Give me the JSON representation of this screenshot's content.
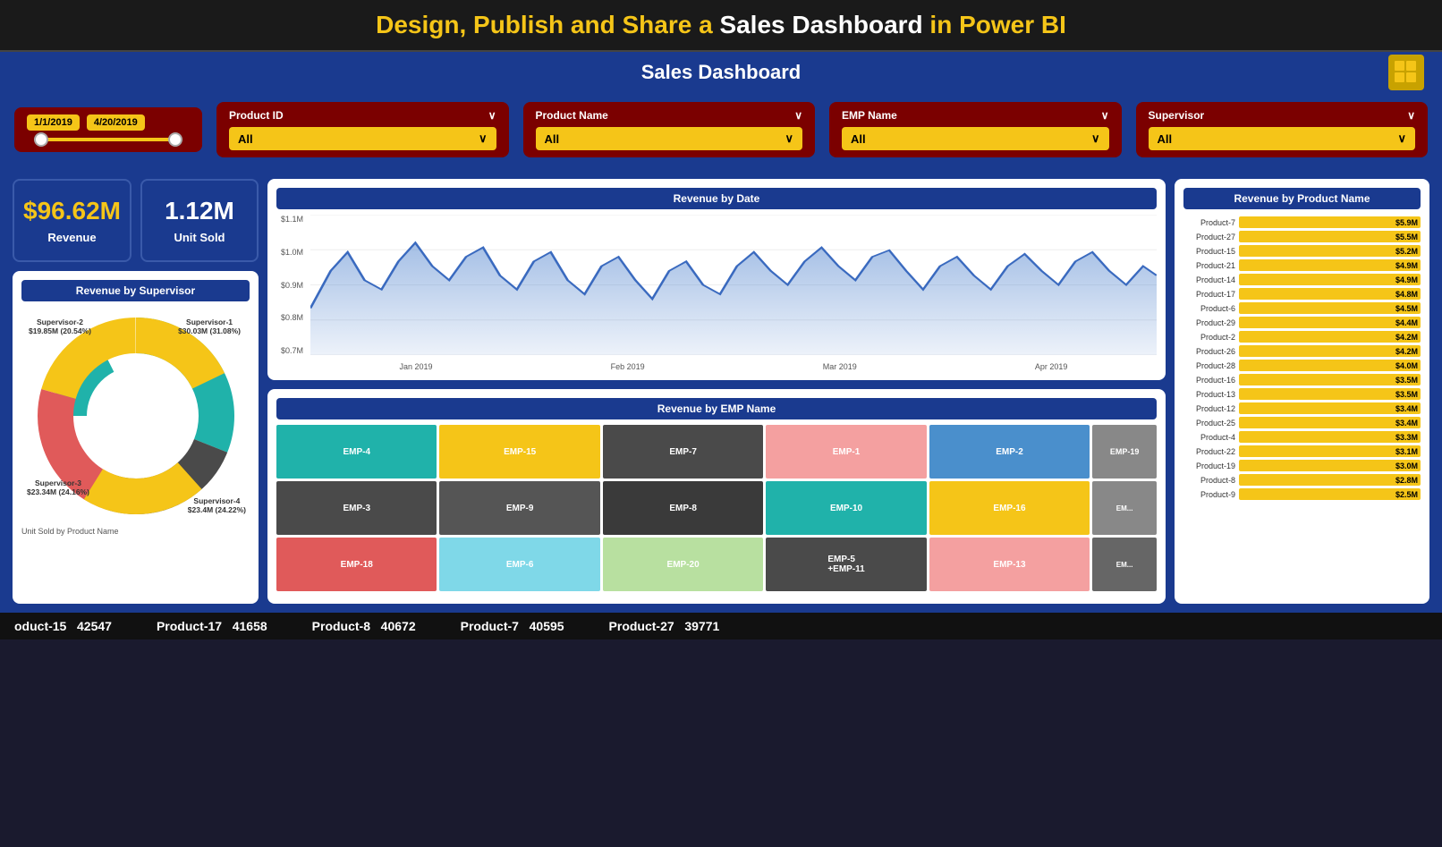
{
  "title_bar": {
    "text_yellow": "Design, Publish and Share a ",
    "text_white": "Sales Dashboard",
    "text_yellow2": " in Power BI"
  },
  "header": {
    "title": "Sales Dashboard"
  },
  "filters": {
    "date": {
      "start": "1/1/2019",
      "end": "4/20/2019"
    },
    "product_id": {
      "label": "Product ID",
      "value": "All"
    },
    "product_name": {
      "label": "Product Name",
      "value": "All"
    },
    "emp_name": {
      "label": "EMP Name",
      "value": "All"
    },
    "supervisor": {
      "label": "Supervisor",
      "value": "All"
    }
  },
  "kpis": {
    "revenue": {
      "value": "$96.62M",
      "label": "Revenue"
    },
    "units": {
      "value": "1.12M",
      "label": "Unit Sold"
    }
  },
  "supervisor_chart": {
    "title": "Revenue by Supervisor",
    "segments": [
      {
        "name": "Supervisor-1",
        "value": "$30.03M (31.08%)",
        "color": "#20b2aa",
        "pct": 31.08
      },
      {
        "name": "Supervisor-4",
        "value": "$23.4M (24.22%)",
        "color": "#4a4a4a",
        "pct": 24.22
      },
      {
        "name": "Supervisor-3",
        "value": "$23.34M (24.16%)",
        "color": "#e05a5a",
        "pct": 24.16
      },
      {
        "name": "Supervisor-2",
        "value": "$19.85M (20.54%)",
        "color": "#f5c518",
        "pct": 20.54
      }
    ]
  },
  "revenue_by_date": {
    "title": "Revenue by Date",
    "y_labels": [
      "$1.1M",
      "$1.0M",
      "$0.9M",
      "$0.8M",
      "$0.7M"
    ],
    "x_labels": [
      "Jan 2019",
      "Feb 2019",
      "Mar 2019",
      "Apr 2019"
    ]
  },
  "revenue_by_emp": {
    "title": "Revenue by EMP Name",
    "cells": [
      {
        "label": "EMP-4",
        "color": "#20b2aa",
        "col": 1,
        "row": 1,
        "colspan": 1,
        "rowspan": 1
      },
      {
        "label": "EMP-15",
        "color": "#f5c518",
        "col": 2,
        "row": 1,
        "colspan": 1,
        "rowspan": 1
      },
      {
        "label": "EMP-7",
        "color": "#4a4a4a",
        "col": 3,
        "row": 1,
        "colspan": 1,
        "rowspan": 1
      },
      {
        "label": "EMP-1",
        "color": "#f4a0a0",
        "col": 4,
        "row": 1,
        "colspan": 1,
        "rowspan": 1
      },
      {
        "label": "EMP-2",
        "color": "#4a8fcc",
        "col": 5,
        "row": 1,
        "colspan": 1,
        "rowspan": 1
      },
      {
        "label": "EMP-19",
        "color": "#666",
        "col": 6,
        "row": 1,
        "colspan": 1,
        "rowspan": 1
      },
      {
        "label": "EMP-3",
        "color": "#4a4a4a",
        "col": 1,
        "row": 2,
        "colspan": 1,
        "rowspan": 1
      },
      {
        "label": "EMP-9",
        "color": "#4a4a4a",
        "col": 2,
        "row": 2,
        "colspan": 1,
        "rowspan": 1
      },
      {
        "label": "EMP-8",
        "color": "#4a4a4a",
        "col": 3,
        "row": 2,
        "colspan": 1,
        "rowspan": 1
      },
      {
        "label": "EMP-10",
        "color": "#20b2aa",
        "col": 4,
        "row": 2,
        "colspan": 1,
        "rowspan": 1
      },
      {
        "label": "EMP-16",
        "color": "#f5c518",
        "col": 5,
        "row": 2,
        "colspan": 1,
        "rowspan": 1
      },
      {
        "label": "EMP-18",
        "color": "#e05a5a",
        "col": 1,
        "row": 3,
        "colspan": 1,
        "rowspan": 1
      },
      {
        "label": "EMP-6",
        "color": "#7fd8e8",
        "col": 2,
        "row": 3,
        "colspan": 1,
        "rowspan": 1
      },
      {
        "label": "EMP-20",
        "color": "#b8e0a0",
        "col": 3,
        "row": 3,
        "colspan": 1,
        "rowspan": 1
      },
      {
        "label": "EMP-5",
        "color": "#4a4a4a",
        "col": 4,
        "row": 2.5,
        "colspan": 1,
        "rowspan": 1
      },
      {
        "label": "EMP-11",
        "color": "#e05a5a",
        "col": 4,
        "row": 3,
        "colspan": 1,
        "rowspan": 1
      },
      {
        "label": "EMP-13",
        "color": "#f4a0a0",
        "col": 5,
        "row": 3,
        "colspan": 1,
        "rowspan": 1
      }
    ]
  },
  "revenue_by_product": {
    "title": "Revenue by Product Name",
    "items": [
      {
        "name": "Product-7",
        "value": "$5.9M",
        "pct": 100
      },
      {
        "name": "Product-27",
        "value": "$5.5M",
        "pct": 93
      },
      {
        "name": "Product-15",
        "value": "$5.2M",
        "pct": 88
      },
      {
        "name": "Product-21",
        "value": "$4.9M",
        "pct": 83
      },
      {
        "name": "Product-14",
        "value": "$4.9M",
        "pct": 83
      },
      {
        "name": "Product-17",
        "value": "$4.8M",
        "pct": 81
      },
      {
        "name": "Product-6",
        "value": "$4.5M",
        "pct": 76
      },
      {
        "name": "Product-29",
        "value": "$4.4M",
        "pct": 75
      },
      {
        "name": "Product-2",
        "value": "$4.2M",
        "pct": 71
      },
      {
        "name": "Product-26",
        "value": "$4.2M",
        "pct": 71
      },
      {
        "name": "Product-28",
        "value": "$4.0M",
        "pct": 68
      },
      {
        "name": "Product-16",
        "value": "$3.5M",
        "pct": 59
      },
      {
        "name": "Product-13",
        "value": "$3.5M",
        "pct": 59
      },
      {
        "name": "Product-12",
        "value": "$3.4M",
        "pct": 58
      },
      {
        "name": "Product-25",
        "value": "$3.4M",
        "pct": 58
      },
      {
        "name": "Product-4",
        "value": "$3.3M",
        "pct": 56
      },
      {
        "name": "Product-22",
        "value": "$3.1M",
        "pct": 53
      },
      {
        "name": "Product-19",
        "value": "$3.0M",
        "pct": 51
      },
      {
        "name": "Product-8",
        "value": "$2.8M",
        "pct": 47
      },
      {
        "name": "Product-9",
        "value": "$2.5M",
        "pct": 42
      }
    ]
  },
  "ticker": {
    "items": [
      {
        "label": "oduct-15",
        "value": "42547"
      },
      {
        "label": "Product-17",
        "value": "41658"
      },
      {
        "label": "Product-8",
        "value": "40672"
      },
      {
        "label": "Product-7",
        "value": "40595"
      },
      {
        "label": "Product-27",
        "value": "39771"
      }
    ]
  },
  "unit_sold_label": "Unit Sold by Product Name"
}
